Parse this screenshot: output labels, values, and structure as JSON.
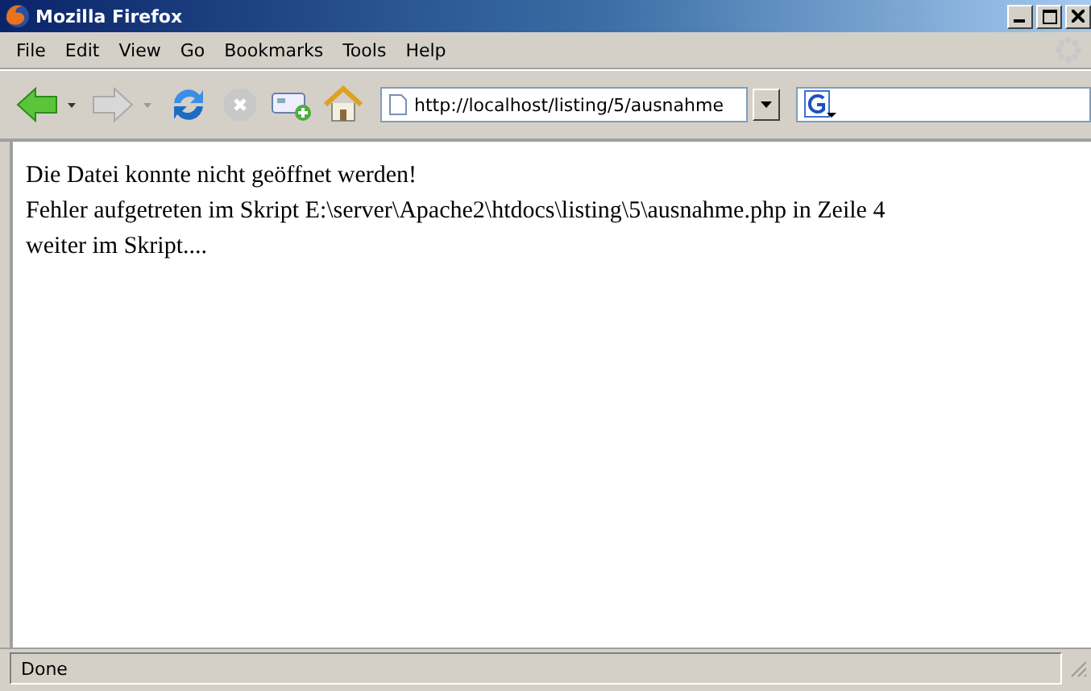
{
  "window": {
    "title": "Mozilla Firefox"
  },
  "menu": [
    "File",
    "Edit",
    "View",
    "Go",
    "Bookmarks",
    "Tools",
    "Help"
  ],
  "toolbar": {
    "back_disabled": false,
    "forward_disabled": true,
    "stop_disabled": true
  },
  "address": {
    "value": "http://localhost/listing/5/ausnahme"
  },
  "content": {
    "lines": [
      "Die Datei konnte nicht geöffnet werden!",
      "Fehler aufgetreten im Skript E:\\server\\Apache2\\htdocs\\listing\\5\\ausnahme.php in Zeile 4",
      "weiter im Skript...."
    ]
  },
  "status_bar": {
    "text": "Done"
  }
}
